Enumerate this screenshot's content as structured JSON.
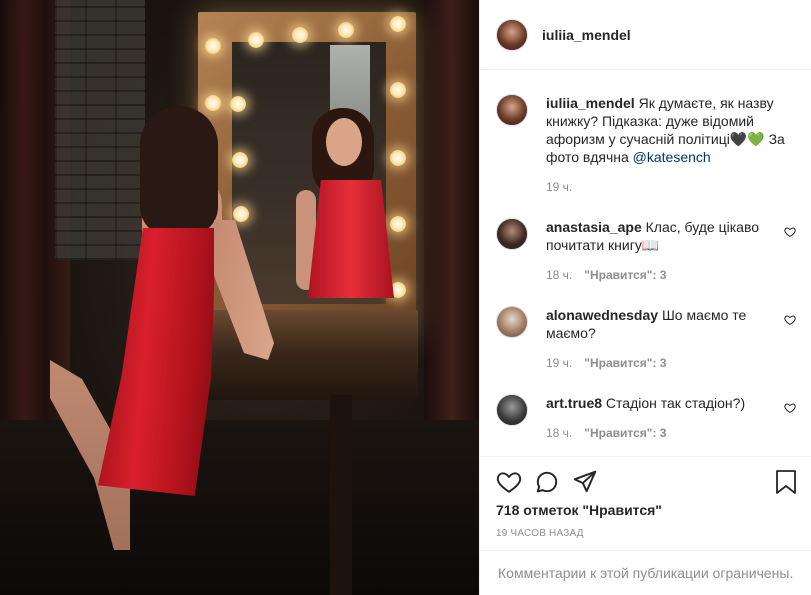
{
  "post": {
    "author": "iuliia_mendel",
    "caption": {
      "author": "iuliia_mendel",
      "text": "Як думаєте, як назву книжку? Підказка: дуже відомий афоризм у сучасній політиці🖤💚 За фото вдячна",
      "mention": "@katesench",
      "time": "19 ч."
    },
    "comments": [
      {
        "author": "anastasia_ape",
        "text": "Клас, буде цікаво почитати книгу📖",
        "time": "18 ч.",
        "likes": "\"Нравится\": 3"
      },
      {
        "author": "alonawednesday",
        "text": "Шо маємо те маємо?",
        "time": "19 ч.",
        "likes": "\"Нравится\": 3"
      },
      {
        "author": "art.true8",
        "text": "Стадіон так стадіон?)",
        "time": "18 ч.",
        "likes": "\"Нравится\": 3"
      }
    ],
    "likes_count": "718 отметок \"Нравится\"",
    "timestamp": "19 часов назад",
    "comments_disabled": "Комментарии к этой публикации ограничены."
  },
  "icons": {
    "like": "heart-icon",
    "comment": "comment-icon",
    "share": "share-icon",
    "save": "bookmark-icon"
  }
}
